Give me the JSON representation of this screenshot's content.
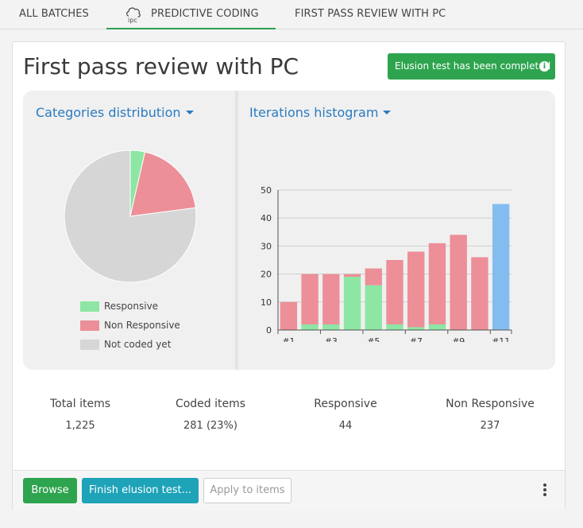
{
  "tabs": [
    {
      "label": "ALL BATCHES"
    },
    {
      "label": "PREDICTIVE CODING",
      "icon": "ipc-icon",
      "active": true
    },
    {
      "label": "FIRST PASS REVIEW WITH PC"
    }
  ],
  "page": {
    "title": "First pass review with PC",
    "status_badge": "Elusion test has been completed",
    "status_color": "#2ea44f"
  },
  "panels": {
    "left_title": "Categories distribution",
    "right_title": "Iterations histogram"
  },
  "chart_data": [
    {
      "type": "pie",
      "labels": [
        "Responsive",
        "Non Responsive",
        "Not coded yet"
      ],
      "values": [
        44,
        237,
        944
      ],
      "colors": [
        "#8de6a3",
        "#ec8f98",
        "#d6d6d6"
      ],
      "legend_position": "bottom"
    },
    {
      "type": "bar",
      "stacked": true,
      "categories": [
        "#1",
        "#2",
        "#3",
        "#4",
        "#5",
        "#6",
        "#7",
        "#8",
        "#9",
        "#10",
        "#11"
      ],
      "tick_labels": [
        "#1",
        "#3",
        "#5",
        "#7",
        "#9",
        "#11"
      ],
      "series": [
        {
          "values": [
            0,
            2,
            2,
            19,
            16,
            2,
            1,
            2,
            0,
            0,
            0
          ],
          "color": "#8de6a3"
        },
        {
          "values": [
            10,
            18,
            18,
            1,
            6,
            23,
            27,
            29,
            34,
            26,
            0
          ],
          "color": "#ec8f98"
        },
        {
          "values": [
            0,
            0,
            0,
            0,
            0,
            0,
            0,
            0,
            0,
            0,
            45
          ],
          "color": "#85bcf0"
        }
      ],
      "ylim": [
        0,
        50
      ],
      "yticks": [
        0,
        10,
        20,
        30,
        40,
        50
      ],
      "grid": true
    }
  ],
  "stats": [
    {
      "label": "Total items",
      "value": "1,225"
    },
    {
      "label": "Coded items",
      "value": "281 (23%)"
    },
    {
      "label": "Responsive",
      "value": "44"
    },
    {
      "label": "Non Responsive",
      "value": "237"
    }
  ],
  "footer": {
    "browse": "Browse",
    "finish": "Finish elusion test...",
    "apply": "Apply to items",
    "more_icon": "more-vertical-icon"
  }
}
